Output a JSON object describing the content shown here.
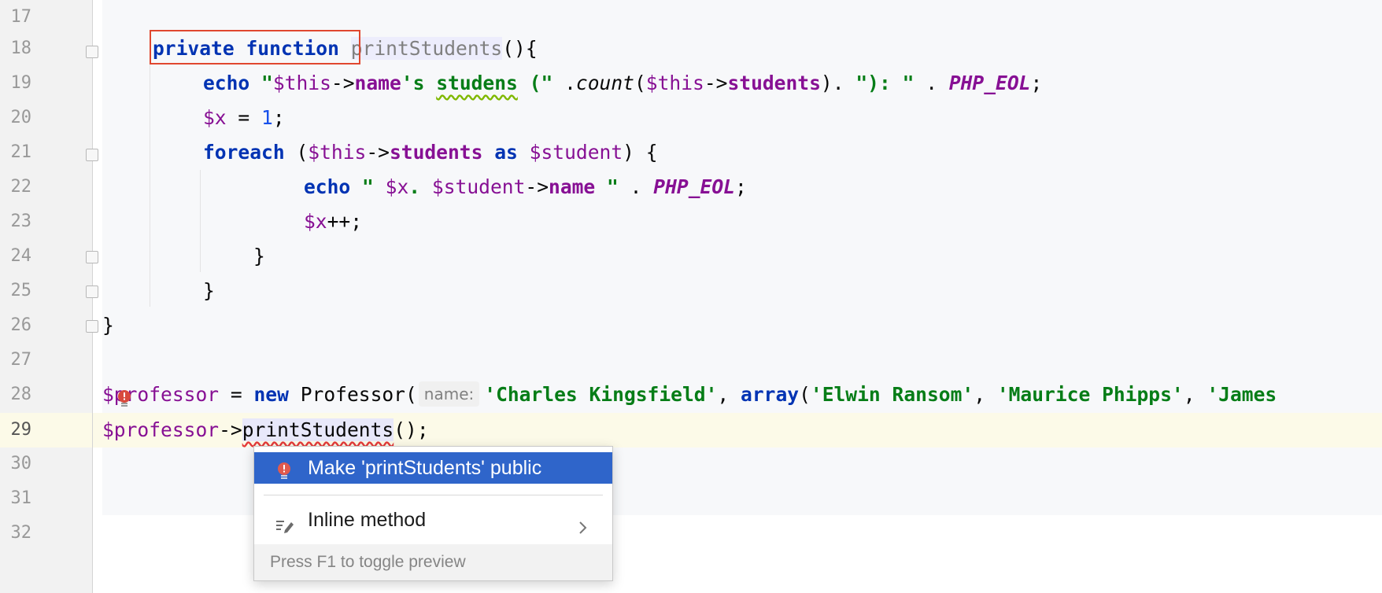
{
  "editor": {
    "line_numbers": [
      "17",
      "18",
      "19",
      "20",
      "21",
      "22",
      "23",
      "24",
      "25",
      "26",
      "27",
      "28",
      "29",
      "30",
      "31",
      "32"
    ],
    "current_line": "29",
    "lines": {
      "l18": {
        "kw1": "private",
        "kw2": "function",
        "fn": "printStudents",
        "rest": "(){"
      },
      "l19": {
        "kw": "echo",
        "s1": "\"",
        "v1": "$this",
        "a1": "->",
        "p1": "name",
        "s2": "'s",
        "s3": "studens",
        "s4": "(\"",
        "t1": " .",
        "fn": "count",
        "t2": "(",
        "v2": "$this",
        "a2": "->",
        "p2": "students",
        "t3": "). ",
        "s5": "\"): \"",
        "t4": " . ",
        "c1": "PHP_EOL",
        "t5": ";"
      },
      "l20": {
        "v": "$x",
        "t1": " = ",
        "n": "1",
        "t2": ";"
      },
      "l21": {
        "kw": "foreach",
        "t1": " (",
        "v1": "$this",
        "a1": "->",
        "p1": "students",
        "kw2": "as",
        "v2": "$student",
        "t2": ") {"
      },
      "l22": {
        "kw": "echo",
        "s1": "\" ",
        "v1": "$x",
        "s2": ". ",
        "v2": "$student",
        "a1": "->",
        "p1": "name",
        "s3": " \"",
        "t1": " . ",
        "c1": "PHP_EOL",
        "t2": ";"
      },
      "l23": {
        "v": "$x",
        "t": "++;"
      },
      "l24": {
        "t": "}"
      },
      "l25": {
        "t": "}"
      },
      "l26": {
        "t": "}"
      },
      "l28": {
        "v1": "$professor",
        "t1": " = ",
        "kw": "new",
        "t2": " Professor(",
        "hint": "name:",
        "s1": "'Charles Kingsfield'",
        "t3": ", ",
        "kw2": "array",
        "t4": "(",
        "s2": "'Elwin Ransom'",
        "t5": ", ",
        "s3": "'Maurice Phipps'",
        "t6": ", ",
        "s4": "'James"
      },
      "l29": {
        "v1": "$professor",
        "a1": "->",
        "fn": "printStudents",
        "t1": "();"
      }
    }
  },
  "popup": {
    "items": [
      {
        "label": "Make 'printStudents' public",
        "icon": "error-bulb-icon"
      },
      {
        "label": "Inline method",
        "icon": "refactor-pencil-icon",
        "submenu": "chevron-right-icon"
      }
    ],
    "footer": "Press F1 to toggle preview"
  },
  "colors": {
    "keyword": "#0033b3",
    "string": "#067d17",
    "property": "#871094",
    "number": "#1750eb",
    "selection": "#2f65ca",
    "highlight_box": "#e0472f",
    "current_line": "#fcfae8"
  }
}
